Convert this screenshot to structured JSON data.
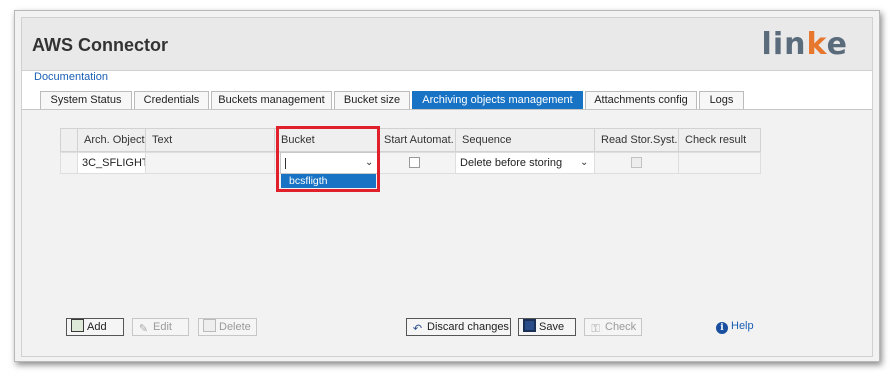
{
  "app": {
    "title": "AWS Connector",
    "logo_text_start": "lin",
    "logo_text_accent": "k",
    "logo_text_end": "e"
  },
  "doc_link": "Documentation",
  "tabs": [
    {
      "label": "System Status",
      "active": false
    },
    {
      "label": "Credentials",
      "active": false
    },
    {
      "label": "Buckets management",
      "active": false
    },
    {
      "label": "Bucket size",
      "active": false
    },
    {
      "label": "Archiving objects management",
      "active": true
    },
    {
      "label": "Attachments config",
      "active": false
    },
    {
      "label": "Logs",
      "active": false
    }
  ],
  "table": {
    "headers": [
      "Arch. Object",
      "Text",
      "Bucket",
      "Start Automat.",
      "Sequence",
      "Read Stor.Syst.",
      "Check result"
    ],
    "row": {
      "arch_object": "3C_SFLIGHT",
      "text": "",
      "bucket_value": "",
      "start_automat": false,
      "sequence": "Delete before storing",
      "read_stor_syst": false,
      "check_result": ""
    },
    "bucket_dropdown_options": [
      "bcsfligth"
    ]
  },
  "buttons": {
    "add": "Add",
    "edit": "Edit",
    "delete": "Delete",
    "discard": "Discard changes",
    "save": "Save",
    "check": "Check",
    "help": "Help"
  },
  "colors": {
    "accent": "#1873c4",
    "logo_gray": "#5a6b7c",
    "logo_orange": "#e8772e",
    "highlight": "#e0202a"
  },
  "icons": {
    "add": "add-row-icon",
    "edit": "pencil-icon",
    "delete": "delete-row-icon",
    "discard": "undo-icon",
    "save": "floppy-disk-icon",
    "check": "check-lock-icon",
    "help": "info-icon",
    "dropdown": "chevron-down-icon"
  }
}
